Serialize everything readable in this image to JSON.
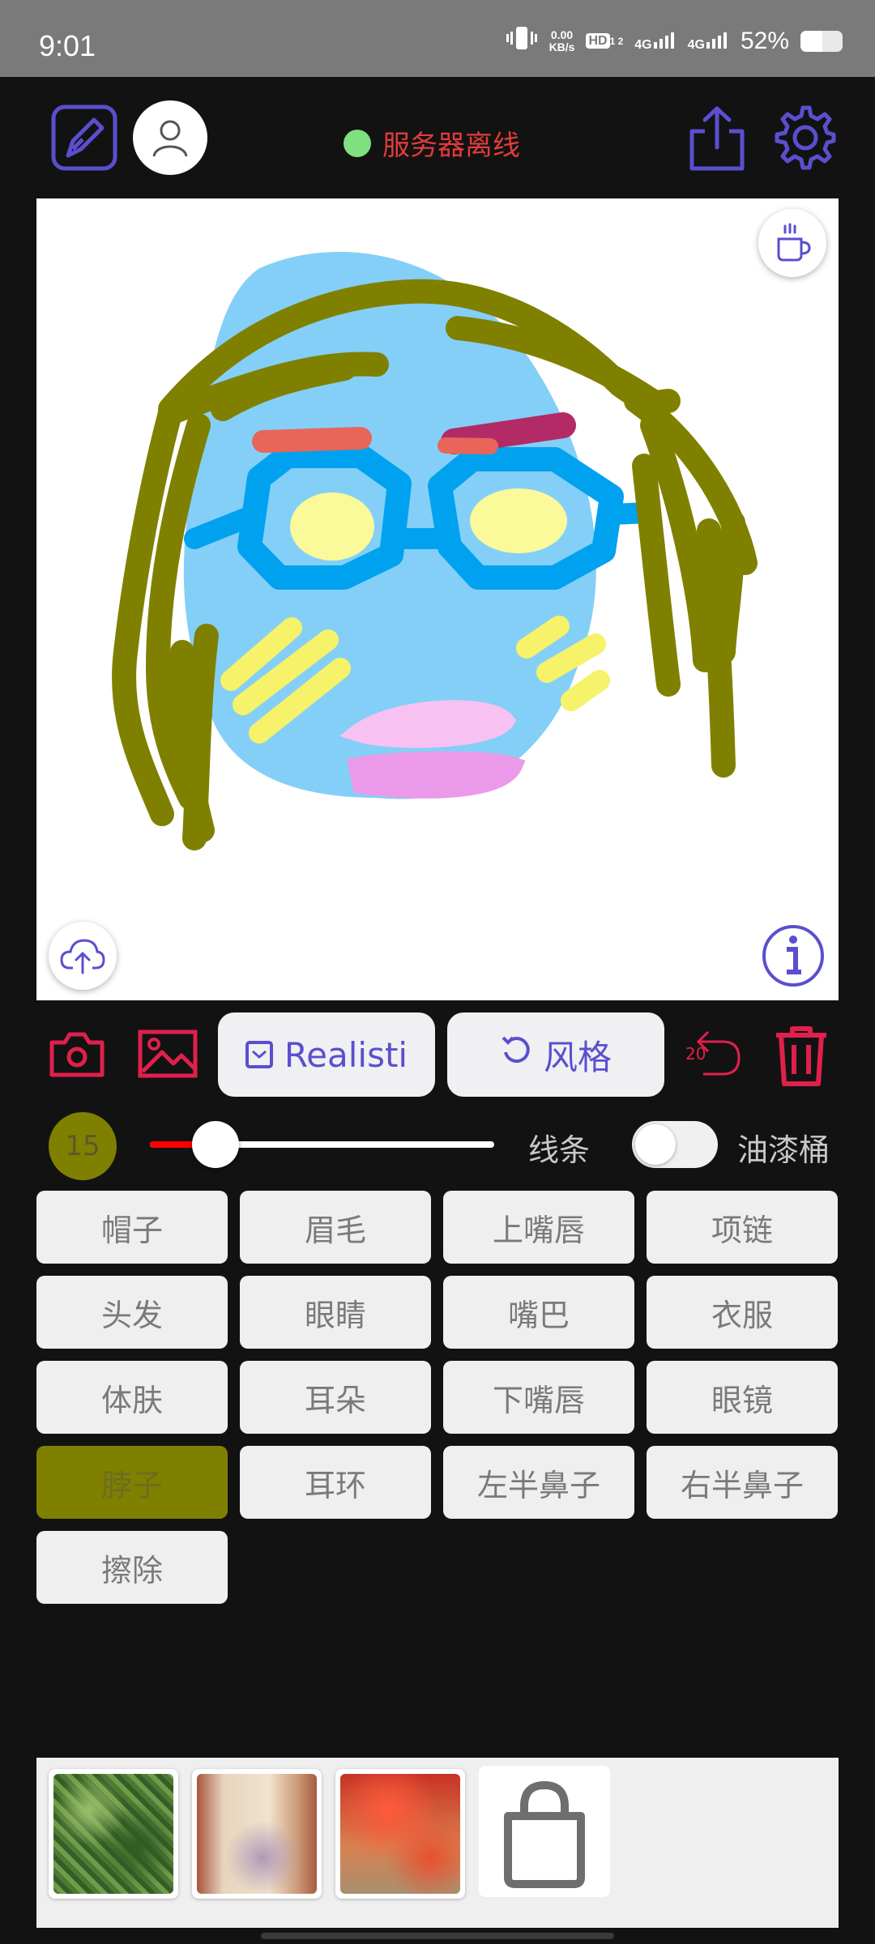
{
  "status_bar": {
    "time": "9:01",
    "net_speed_value": "0.00",
    "net_speed_unit": "KB/s",
    "hd_label": "HD",
    "hd_sub": "1 2",
    "sig1": "4G",
    "sig2": "4G",
    "battery": "52%",
    "battery_level": 0.52
  },
  "toolbar": {
    "edit_icon": "edit-square-icon",
    "avatar_icon": "user-avatar-icon",
    "server_status": "服务器离线",
    "server_status_color": "#e33b3b",
    "server_dot_color": "#7ee07e",
    "share_icon": "share-icon",
    "settings_icon": "gear-icon",
    "icon_color": "#5a4fcf"
  },
  "canvas": {
    "coffee_icon": "coffee-cup-icon",
    "upload_icon": "cloud-upload-icon",
    "info_icon": "info-icon"
  },
  "actions": {
    "camera_icon": "camera-icon",
    "gallery_icon": "image-icon",
    "realistic_label": "Realisti",
    "style_label": "风格",
    "undo_count": "20",
    "undo_icon": "undo-icon",
    "delete_icon": "trash-icon",
    "accent": "#e0204c"
  },
  "brush": {
    "size": "15",
    "size_fraction": 0.19,
    "line_label": "线条",
    "bucket_label": "油漆桶",
    "bucket_enabled": false,
    "color": "#808000"
  },
  "parts": [
    {
      "label": "帽子",
      "selected": false
    },
    {
      "label": "眉毛",
      "selected": false
    },
    {
      "label": "上嘴唇",
      "selected": false
    },
    {
      "label": "项链",
      "selected": false
    },
    {
      "label": "头发",
      "selected": false
    },
    {
      "label": "眼睛",
      "selected": false
    },
    {
      "label": "嘴巴",
      "selected": false
    },
    {
      "label": "衣服",
      "selected": false
    },
    {
      "label": "体肤",
      "selected": false
    },
    {
      "label": "耳朵",
      "selected": false
    },
    {
      "label": "下嘴唇",
      "selected": false
    },
    {
      "label": "眼镜",
      "selected": false
    },
    {
      "label": "脖子",
      "selected": true
    },
    {
      "label": "耳环",
      "selected": false
    },
    {
      "label": "左半鼻子",
      "selected": false
    },
    {
      "label": "右半鼻子",
      "selected": false
    },
    {
      "label": "擦除",
      "selected": false
    }
  ],
  "thumbnails": {
    "shop_icon": "shopping-bag-icon"
  }
}
